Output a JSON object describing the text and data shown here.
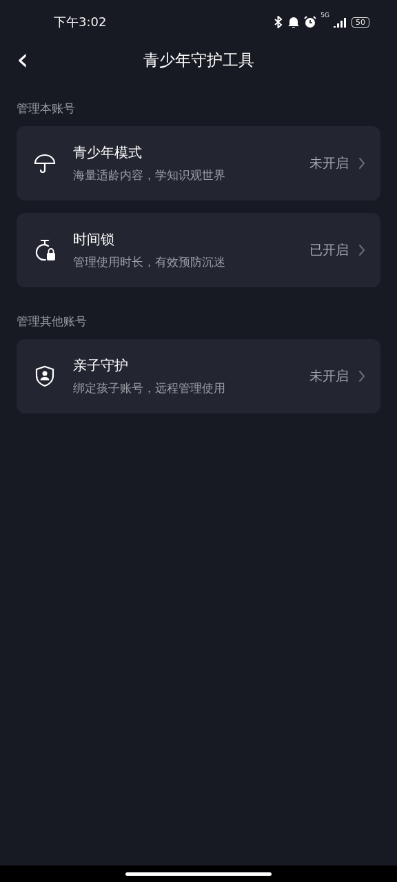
{
  "status_bar": {
    "time": "下午3:02",
    "network": "5G",
    "battery": "50"
  },
  "nav": {
    "back": "‹",
    "title": "青少年守护工具"
  },
  "sections": [
    {
      "label": "管理本账号",
      "items": [
        {
          "kind": "umbrella",
          "title": "青少年模式",
          "subtitle": "海量适龄内容，学知识观世界",
          "status": "未开启"
        },
        {
          "kind": "timer-lock",
          "title": "时间锁",
          "subtitle": "管理使用时长，有效预防沉迷",
          "status": "已开启"
        }
      ]
    },
    {
      "label": "管理其他账号",
      "items": [
        {
          "kind": "shield-person",
          "title": "亲子守护",
          "subtitle": "绑定孩子账号，远程管理使用",
          "status": "未开启"
        }
      ]
    }
  ]
}
